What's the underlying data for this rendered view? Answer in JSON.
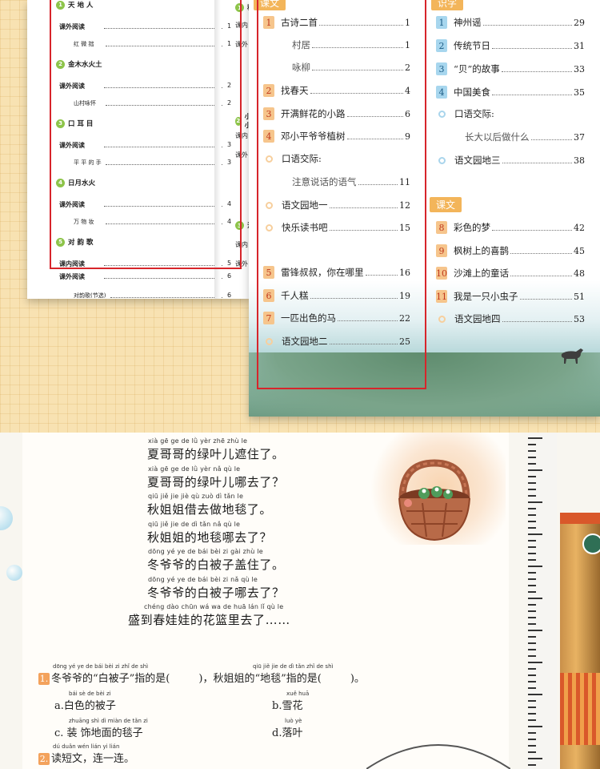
{
  "left_book": {
    "units": [
      {
        "num": "1",
        "title": "天 地 人",
        "sub_label": "课外阅读",
        "sub_page": "1",
        "poem": "红 微 拙",
        "poem_page": "1"
      },
      {
        "num": "2",
        "title": "金木水火土",
        "sub_label": "课外阅读",
        "sub_page": "2",
        "poem": "山村咏怀",
        "poem_page": "2"
      },
      {
        "num": "3",
        "title": "口 耳 目",
        "sub_label": "课外阅读",
        "sub_page": "3",
        "poem": "平 平 的 手",
        "poem_page": "3"
      },
      {
        "num": "4",
        "title": "日月水火",
        "sub_label": "课外阅读",
        "sub_page": "4",
        "poem": "万 物 妆",
        "poem_page": "4"
      },
      {
        "num": "5",
        "title": "对 韵 歌",
        "sub_label": "课内阅读",
        "sub_page": "5",
        "poem": "",
        "poem_page": ""
      }
    ],
    "extra": [
      {
        "label": "课外阅读",
        "page": "6"
      },
      {
        "label": "对韵歌(节选)",
        "page": "6"
      }
    ],
    "col2": [
      {
        "num": "1",
        "text": "秋"
      },
      {
        "text": "课内"
      },
      {
        "text": "课外"
      },
      {
        "num": "2",
        "text": "小小"
      },
      {
        "text": "课内"
      },
      {
        "text": "课外"
      },
      {
        "num": "3",
        "text": "江"
      },
      {
        "text": "课内"
      },
      {
        "text": "课外"
      }
    ]
  },
  "right_book": {
    "tab_left": "课文",
    "tab_right": "识字",
    "tab_lower": "课文",
    "col1": [
      {
        "num": "1",
        "title": "古诗二首",
        "page": "1"
      },
      {
        "num": "",
        "title": "村居",
        "page": "1",
        "indent": true
      },
      {
        "num": "",
        "title": "咏柳",
        "page": "2",
        "indent": true
      },
      {
        "num": "2",
        "title": "找春天",
        "page": "4"
      },
      {
        "num": "3",
        "title": "开满鲜花的小路",
        "page": "6"
      },
      {
        "num": "4",
        "title": "邓小平爷爷植树",
        "page": "9"
      },
      {
        "num": "o",
        "title": "口语交际:",
        "page": ""
      },
      {
        "num": "",
        "title": "注意说话的语气",
        "page": "11",
        "indent": true
      },
      {
        "num": "o",
        "title": "语文园地一",
        "page": "12"
      },
      {
        "num": "o",
        "title": "快乐读书吧",
        "page": "15"
      },
      {
        "num": "5",
        "title": "雷锋叔叔，你在哪里",
        "page": "16"
      },
      {
        "num": "6",
        "title": "千人糕",
        "page": "19"
      },
      {
        "num": "7",
        "title": "一匹出色的马",
        "page": "22"
      },
      {
        "num": "o",
        "title": "语文园地二",
        "page": "25"
      }
    ],
    "col2": [
      {
        "num": "1",
        "title": "神州谣",
        "page": "29"
      },
      {
        "num": "2",
        "title": "传统节日",
        "page": "31"
      },
      {
        "num": "3",
        "title": "“贝”的故事",
        "page": "33"
      },
      {
        "num": "4",
        "title": "中国美食",
        "page": "35"
      },
      {
        "num": "o",
        "title": "口语交际:",
        "page": ""
      },
      {
        "num": "",
        "title": "长大以后做什么",
        "page": "37",
        "indent": true
      },
      {
        "num": "o",
        "title": "语文园地三",
        "page": "38"
      },
      {
        "num": "8",
        "title": "彩色的梦",
        "page": "42"
      },
      {
        "num": "9",
        "title": "枫树上的喜鹊",
        "page": "45"
      },
      {
        "num": "10",
        "title": "沙滩上的童话",
        "page": "48"
      },
      {
        "num": "11",
        "title": "我是一只小虫子",
        "page": "51"
      },
      {
        "num": "o",
        "title": "语文园地四",
        "page": "53"
      }
    ]
  },
  "poem": [
    {
      "py": "xià gē ge de lǜ yèr zhē zhù le",
      "hz": "夏哥哥的绿叶儿遮住了。"
    },
    {
      "py": "xià gē ge de lǜ yèr nǎ qù le",
      "hz": "夏哥哥的绿叶儿哪去了？"
    },
    {
      "py": "qiū jiě jie jiè qù zuò dì tǎn le",
      "hz": "秋姐姐借去做地毯了。"
    },
    {
      "py": "qiū jiě jie de dì tǎn nǎ qù le",
      "hz": "秋姐姐的地毯哪去了？"
    },
    {
      "py": "dōng yé ye de bái bèi zi gài zhù le",
      "hz": "冬爷爷的白被子盖住了。"
    },
    {
      "py": "dōng yé ye de bái bèi zi nǎ qù le",
      "hz": "冬爷爷的白被子哪去了？"
    },
    {
      "py": "chéng dào chūn wá wa de huā lán lǐ qù le",
      "hz": "盛到春娃娃的花篮里去了……"
    }
  ],
  "questions": {
    "q1_num": "1.",
    "q1_py_a": "dōng yé ye de bái bèi zi zhǐ de shì",
    "q1_text_a": "冬爷爷的“白被子”指的是(",
    "q1_py_b": "qiū jiě jie de dì tǎn zhǐ de shì",
    "q1_text_b": ")，秋姐姐的“地毯”指的是(",
    "q1_end": ")。",
    "opt_a_py": "bái sè de bèi zi",
    "opt_a": "a.白色的被子",
    "opt_b_py": "xuě huā",
    "opt_b": "b.雪花",
    "opt_c_py": "zhuāng shì dì miàn de tǎn zi",
    "opt_c": "c. 装 饰地面的毯子",
    "opt_d_py": "luò yè",
    "opt_d": "d.落叶",
    "q2_num": "2.",
    "q2_py": "dú duǎn wén lián yi lián",
    "q2_text": "读短文，连一连。"
  },
  "colors": {
    "red_box": "#d7252b",
    "unit_badge": "#8dc44a",
    "lesson_num": "#f6c58c",
    "literacy_num": "#a7d6ee",
    "question_num": "#f3a25c"
  }
}
